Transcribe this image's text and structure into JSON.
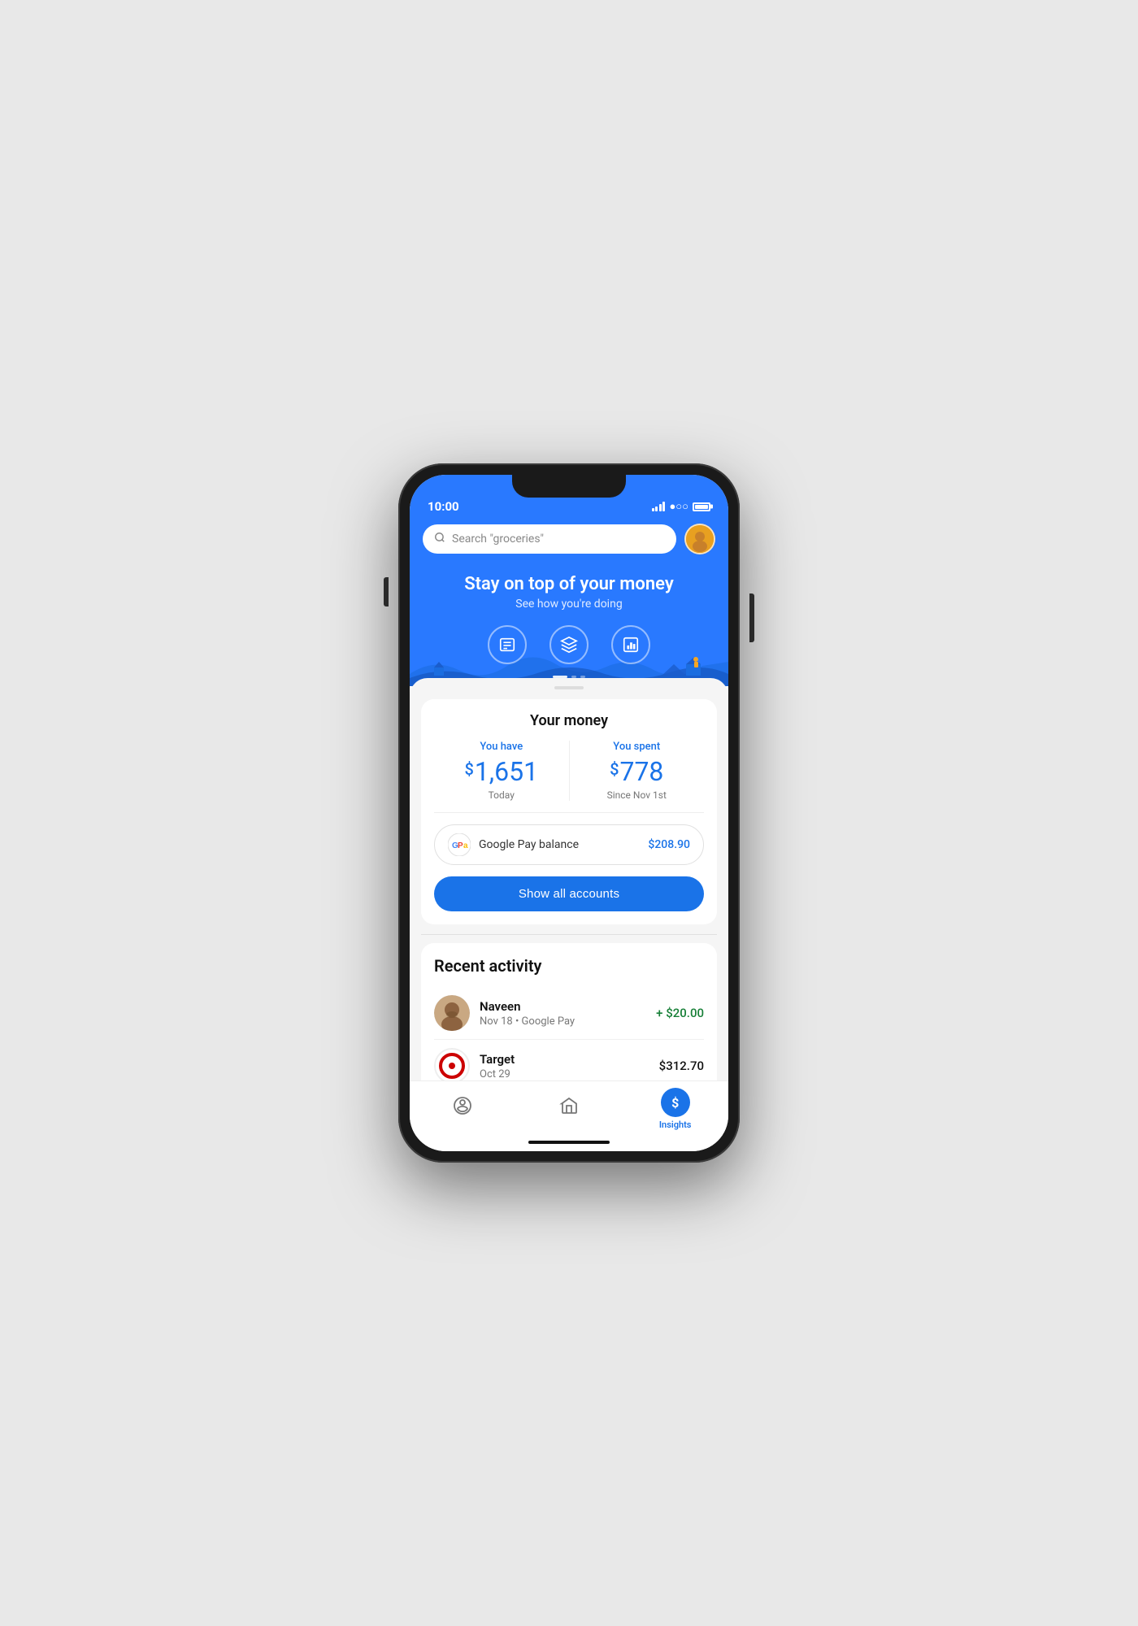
{
  "status_bar": {
    "time": "10:00"
  },
  "header": {
    "search_placeholder": "Search \"groceries\"",
    "hero_title": "Stay on top of your money",
    "hero_subtitle": "See how you're doing",
    "feature_icons": [
      {
        "name": "transactions-icon",
        "symbol": "≡"
      },
      {
        "name": "card-icon",
        "symbol": "◇"
      },
      {
        "name": "chart-icon",
        "symbol": "▦"
      }
    ]
  },
  "money_section": {
    "title": "Your money",
    "you_have_label": "You have",
    "you_have_dollar": "$",
    "you_have_amount": "1,651",
    "you_have_period": "Today",
    "you_spent_label": "You spent",
    "you_spent_dollar": "$",
    "you_spent_amount": "778",
    "you_spent_period": "Since Nov 1st",
    "balance_label": "Google Pay balance",
    "balance_amount": "$208.90",
    "show_accounts_btn": "Show all accounts"
  },
  "recent_activity": {
    "title": "Recent activity",
    "items": [
      {
        "name": "Naveen",
        "detail": "Nov 18 • Google Pay",
        "amount": "+ $20.00",
        "type": "positive",
        "avatar_type": "person"
      },
      {
        "name": "Target",
        "detail": "Oct 29",
        "amount": "$312.70",
        "type": "neutral",
        "avatar_type": "target"
      }
    ]
  },
  "bottom_nav": {
    "items": [
      {
        "label": "",
        "icon": "🏷",
        "name": "pay-nav",
        "active": false
      },
      {
        "label": "",
        "icon": "⌂",
        "name": "home-nav",
        "active": false
      },
      {
        "label": "Insights",
        "icon": "$",
        "name": "insights-nav",
        "active": true
      }
    ]
  }
}
